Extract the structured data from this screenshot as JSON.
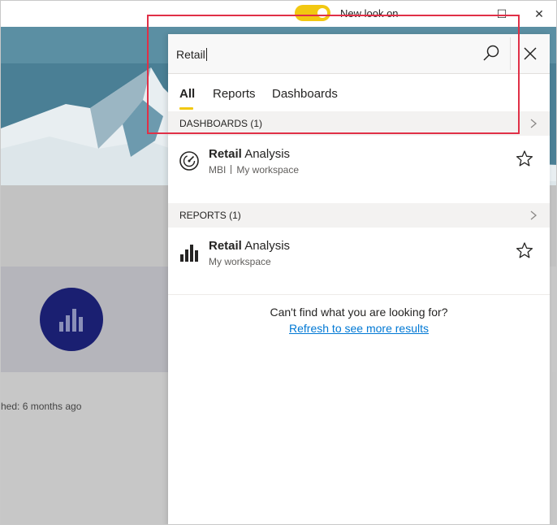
{
  "titlebar": {
    "toggle_label": "New look on",
    "minimize_glyph": "—",
    "maximize_glyph": "☐",
    "close_glyph": "✕"
  },
  "background": {
    "published_text": "hed: 6 months ago"
  },
  "search": {
    "query": "Retail"
  },
  "tabs": [
    {
      "label": "All"
    },
    {
      "label": "Reports"
    },
    {
      "label": "Dashboards"
    }
  ],
  "dashboards_section": {
    "header": "DASHBOARDS (1)",
    "item": {
      "name_bold": "Retail",
      "name_rest": " Analysis",
      "meta_owner": "MBI",
      "meta_workspace": "My workspace"
    }
  },
  "reports_section": {
    "header": "REPORTS (1)",
    "item": {
      "name_bold": "Retail",
      "name_rest": " Analysis",
      "meta_workspace": "My workspace"
    }
  },
  "footer": {
    "not_found": "Can't find what you are looking for?",
    "refresh_link": "Refresh to see more results"
  },
  "colors": {
    "accent_yellow": "#f2c811",
    "link_blue": "#0078d4",
    "report_circle": "#1a1f71",
    "highlight_red": "#e03047"
  },
  "icons": {
    "search": "search-icon",
    "close": "close-icon",
    "dashboard": "gauge-icon",
    "report": "bar-chart-icon",
    "favorite": "star-icon",
    "chevron": "chevron-right-icon"
  }
}
